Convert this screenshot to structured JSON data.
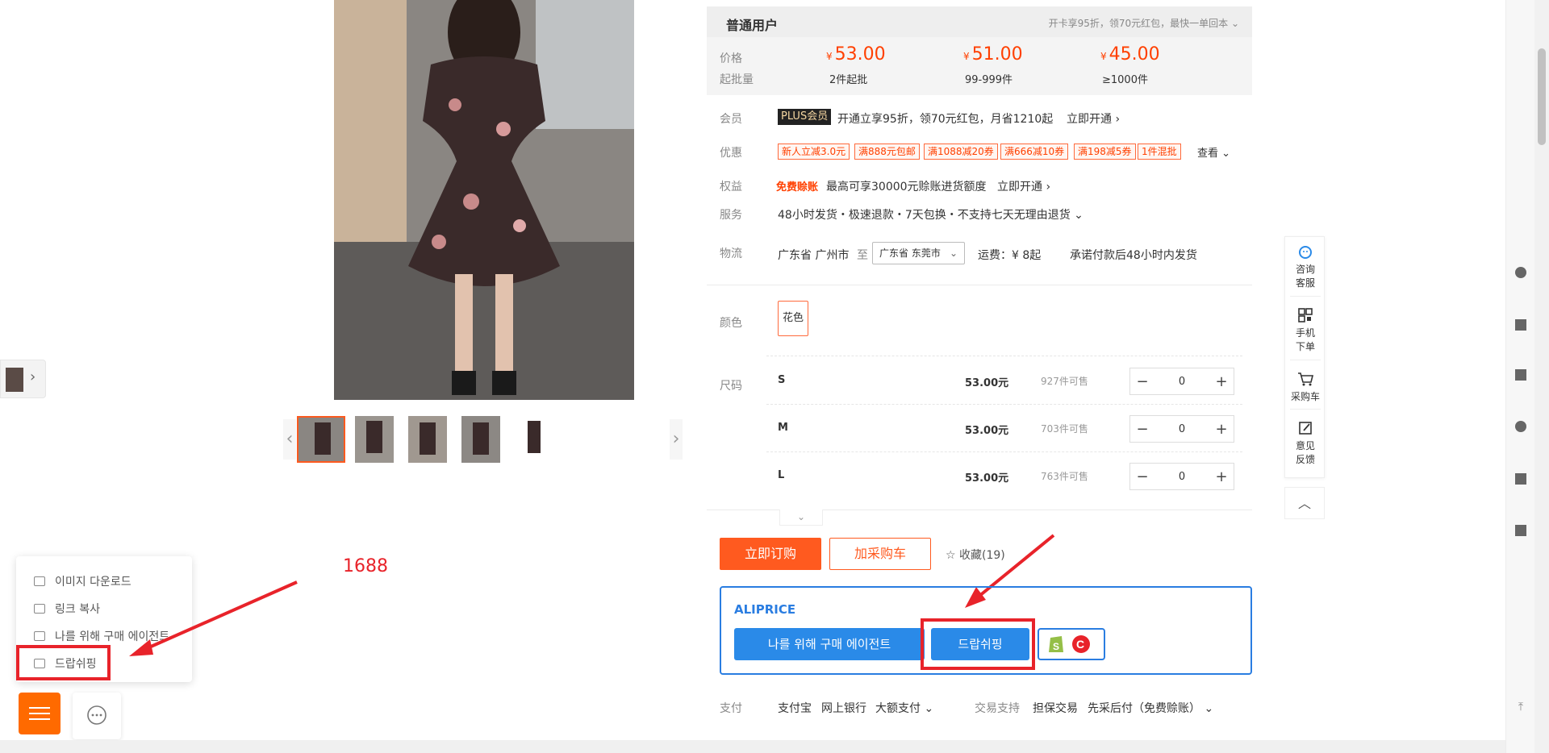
{
  "price_header": {
    "title": "普通用户",
    "tip": "开卡享95折，领70元红包，最快一单回本",
    "price_label": "价格",
    "min_label": "起批量",
    "tiers": [
      {
        "price": "53.00",
        "currency": "¥",
        "min": "2件起批"
      },
      {
        "price": "51.00",
        "currency": "¥",
        "min": "99-999件"
      },
      {
        "price": "45.00",
        "currency": "¥",
        "min": "≥1000件"
      }
    ]
  },
  "member": {
    "label": "会员",
    "badge": "PLUS会员",
    "text": "开通立享95折，领70元红包，月省1210起",
    "link": "立即开通"
  },
  "discount": {
    "label": "优惠",
    "coupons": [
      "新人立减3.0元",
      "满888元包邮",
      "满1088减20券",
      "满666减10券",
      "满198减5券",
      "1件混批"
    ],
    "more": "查看"
  },
  "rights": {
    "label": "权益",
    "tag": "免费赊账",
    "text": "最高可享30000元赊账进货额度",
    "link": "立即开通"
  },
  "service": {
    "label": "服务",
    "text": "48小时发货・极速退款・7天包换・不支持七天无理由退货"
  },
  "logistics": {
    "label": "物流",
    "from": "广东省 广州市",
    "to_label": "至",
    "to_value": "广东省 东莞市",
    "shipping": "运费：¥ 8起",
    "promise": "承诺付款后48小时内发货"
  },
  "color": {
    "label": "颜色",
    "option": "花色"
  },
  "sizes": {
    "label": "尺码",
    "rows": [
      {
        "name": "S",
        "price": "53.00元",
        "stock": "927件可售",
        "qty": "0"
      },
      {
        "name": "M",
        "price": "53.00元",
        "stock": "703件可售",
        "qty": "0"
      },
      {
        "name": "L",
        "price": "53.00元",
        "stock": "763件可售",
        "qty": "0"
      }
    ]
  },
  "actions": {
    "order": "立即订购",
    "cart": "加采购车",
    "favorite": "收藏(19)"
  },
  "aliprice": {
    "title": "ALIPRICE",
    "agent_button": "나를 위해 구매 에이전트",
    "dropship_button": "드랍쉬핑"
  },
  "payment": {
    "label": "支付",
    "methods": [
      "支付宝",
      "网上银行",
      "大额支付"
    ],
    "trade_label": "交易支持",
    "trade_items": [
      "担保交易",
      "先采后付（免费赊账）"
    ]
  },
  "float_bar": {
    "consult": [
      "咨询",
      "客服"
    ],
    "mobile": [
      "手机",
      "下单"
    ],
    "cart": "采购车",
    "feedback": [
      "意见",
      "反馈"
    ]
  },
  "context_menu": {
    "items": [
      "이미지 다운로드",
      "링크 복사",
      "나를 위해 구매 에이전트",
      "드랍쉬핑"
    ]
  },
  "annotation_label": "1688",
  "colors": {
    "accent": "#ff5a1f",
    "price": "#ff4000",
    "aliprice_blue": "#2a8ae8",
    "annotation_red": "#e8232a"
  }
}
